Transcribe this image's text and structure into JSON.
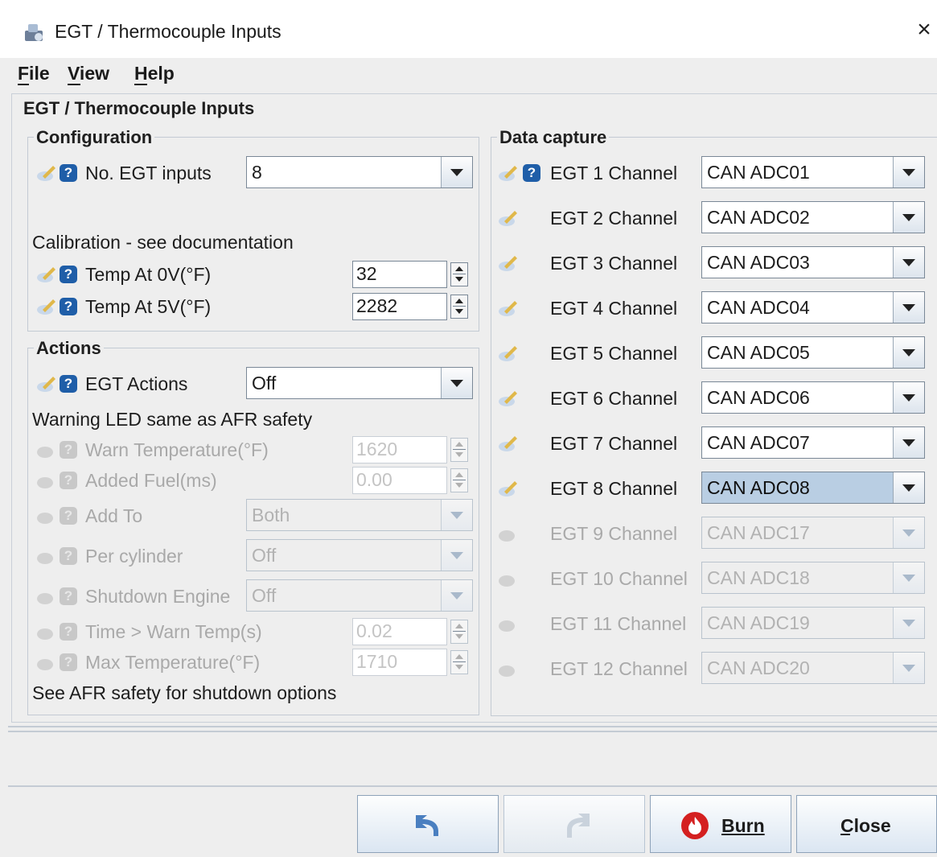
{
  "window": {
    "title": "EGT / Thermocouple Inputs",
    "close_glyph": "×"
  },
  "menu": [
    {
      "label": "File"
    },
    {
      "label": "View"
    },
    {
      "label": "Help"
    }
  ],
  "panel_title": "EGT / Thermocouple Inputs",
  "configuration": {
    "title": "Configuration",
    "egt_inputs": {
      "label": "No. EGT inputs",
      "value": "8"
    },
    "calibration_note": "Calibration - see documentation",
    "temp_0v": {
      "label": "Temp At 0V(°F)",
      "value": "32"
    },
    "temp_5v": {
      "label": "Temp At 5V(°F)",
      "value": "2282"
    }
  },
  "actions": {
    "title": "Actions",
    "egt_actions": {
      "label": "EGT Actions",
      "value": "Off"
    },
    "warning_note": "Warning LED same as AFR safety",
    "warn_temp": {
      "label": "Warn Temperature(°F)",
      "value": "1620"
    },
    "added_fuel": {
      "label": "Added Fuel(ms)",
      "value": "0.00"
    },
    "add_to": {
      "label": "Add To",
      "value": "Both"
    },
    "per_cylinder": {
      "label": "Per cylinder",
      "value": "Off"
    },
    "shutdown_engine": {
      "label": "Shutdown Engine",
      "value": "Off"
    },
    "time_warn": {
      "label": "Time > Warn Temp(s)",
      "value": "0.02"
    },
    "max_temp": {
      "label": "Max Temperature(°F)",
      "value": "1710"
    },
    "footer_note": "See AFR safety for shutdown options"
  },
  "data_capture": {
    "title": "Data capture",
    "channels": [
      {
        "label": "EGT 1 Channel",
        "value": "CAN ADC01"
      },
      {
        "label": "EGT 2 Channel",
        "value": "CAN ADC02"
      },
      {
        "label": "EGT 3 Channel",
        "value": "CAN ADC03"
      },
      {
        "label": "EGT 4 Channel",
        "value": "CAN ADC04"
      },
      {
        "label": "EGT 5 Channel",
        "value": "CAN ADC05"
      },
      {
        "label": "EGT 6 Channel",
        "value": "CAN ADC06"
      },
      {
        "label": "EGT 7 Channel",
        "value": "CAN ADC07"
      },
      {
        "label": "EGT 8 Channel",
        "value": "CAN ADC08"
      },
      {
        "label": "EGT 9 Channel",
        "value": "CAN ADC17"
      },
      {
        "label": "EGT 10 Channel",
        "value": "CAN ADC18"
      },
      {
        "label": "EGT 11 Channel",
        "value": "CAN ADC19"
      },
      {
        "label": "EGT 12 Channel",
        "value": "CAN ADC20"
      }
    ]
  },
  "buttons": {
    "undo_icon": "undo-arrow-icon",
    "redo_icon": "redo-arrow-icon",
    "burn": "Burn",
    "close": "Close"
  },
  "colors": {
    "help_icon": "#1f5ea8",
    "burn_icon": "#d42020",
    "selected_combo": "#b9cee3"
  }
}
